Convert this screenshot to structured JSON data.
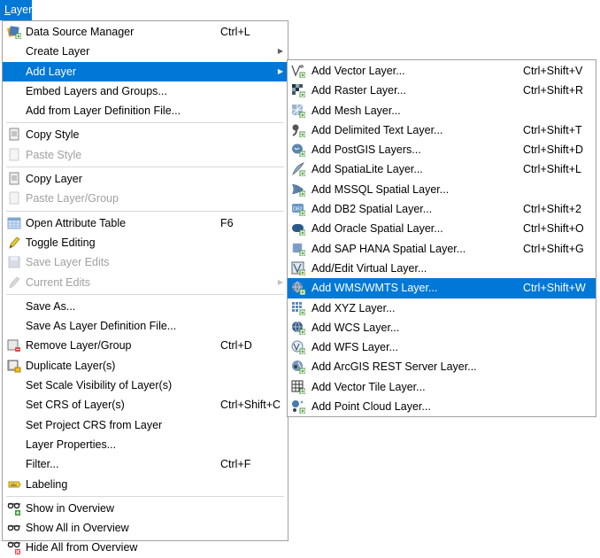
{
  "menubar": {
    "active_menu": "Layer",
    "active_menu_mnemonic": "L",
    "active_menu_rest": "ayer"
  },
  "colors": {
    "highlight": "#0078d7",
    "disabled_text": "#a0a0a0",
    "border": "#a0a0a0"
  },
  "layer_menu": {
    "items": [
      {
        "id": "data-source-manager",
        "label": "Data Source Manager",
        "shortcut": "Ctrl+L",
        "icon": "data-source-manager-icon"
      },
      {
        "id": "create-layer",
        "label": "Create Layer",
        "submenu": true
      },
      {
        "id": "add-layer",
        "label": "Add Layer",
        "submenu": true,
        "highlighted": true
      },
      {
        "id": "embed-layers",
        "label": "Embed Layers and Groups..."
      },
      {
        "id": "add-from-layer-def",
        "label": "Add from Layer Definition File..."
      },
      {
        "separator": true
      },
      {
        "id": "copy-style",
        "label": "Copy Style",
        "icon": "copy-style-icon"
      },
      {
        "id": "paste-style",
        "label": "Paste Style",
        "icon": "paste-style-icon",
        "disabled": true
      },
      {
        "separator": true
      },
      {
        "id": "copy-layer",
        "label": "Copy Layer",
        "icon": "copy-layer-icon"
      },
      {
        "id": "paste-layer-group",
        "label": "Paste Layer/Group",
        "icon": "paste-layer-icon",
        "disabled": true
      },
      {
        "separator": true
      },
      {
        "id": "open-attribute-table",
        "label": "Open Attribute Table",
        "shortcut": "F6",
        "icon": "attribute-table-icon"
      },
      {
        "id": "toggle-editing",
        "label": "Toggle Editing",
        "icon": "pencil-icon"
      },
      {
        "id": "save-layer-edits",
        "label": "Save Layer Edits",
        "icon": "save-edits-icon",
        "disabled": true
      },
      {
        "id": "current-edits",
        "label": "Current Edits",
        "icon": "current-edits-icon",
        "disabled": true,
        "submenu": true
      },
      {
        "separator": true
      },
      {
        "id": "save-as",
        "label": "Save As..."
      },
      {
        "id": "save-as-layer-def",
        "label": "Save As Layer Definition File..."
      },
      {
        "id": "remove-layer-group",
        "label": "Remove Layer/Group",
        "shortcut": "Ctrl+D",
        "icon": "remove-layer-icon"
      },
      {
        "id": "duplicate-layers",
        "label": "Duplicate Layer(s)",
        "icon": "duplicate-layer-icon"
      },
      {
        "id": "set-scale-visibility",
        "label": "Set Scale Visibility of Layer(s)"
      },
      {
        "id": "set-crs-of-layers",
        "label": "Set CRS of Layer(s)",
        "shortcut": "Ctrl+Shift+C"
      },
      {
        "id": "set-project-crs",
        "label": "Set Project CRS from Layer"
      },
      {
        "id": "layer-properties",
        "label": "Layer Properties..."
      },
      {
        "id": "filter",
        "label": "Filter...",
        "shortcut": "Ctrl+F"
      },
      {
        "id": "labeling",
        "label": "Labeling",
        "icon": "labeling-icon"
      },
      {
        "separator": true
      },
      {
        "id": "show-in-overview",
        "label": "Show in Overview",
        "icon": "show-overview-icon"
      },
      {
        "id": "show-all-in-overview",
        "label": "Show All in Overview",
        "icon": "show-all-overview-icon"
      },
      {
        "id": "hide-all-from-overview",
        "label": "Hide All from Overview",
        "icon": "hide-overview-icon"
      }
    ]
  },
  "add_layer_submenu": {
    "items": [
      {
        "id": "add-vector",
        "label": "Add Vector Layer...",
        "shortcut": "Ctrl+Shift+V",
        "icon": "vector-layer-icon"
      },
      {
        "id": "add-raster",
        "label": "Add Raster Layer...",
        "shortcut": "Ctrl+Shift+R",
        "icon": "raster-layer-icon"
      },
      {
        "id": "add-mesh",
        "label": "Add Mesh Layer...",
        "icon": "mesh-layer-icon"
      },
      {
        "id": "add-delimited-text",
        "label": "Add Delimited Text Layer...",
        "shortcut": "Ctrl+Shift+T",
        "icon": "delimited-text-icon"
      },
      {
        "id": "add-postgis",
        "label": "Add PostGIS Layers...",
        "shortcut": "Ctrl+Shift+D",
        "icon": "postgis-icon"
      },
      {
        "id": "add-spatialite",
        "label": "Add SpatiaLite Layer...",
        "shortcut": "Ctrl+Shift+L",
        "icon": "spatialite-icon"
      },
      {
        "id": "add-mssql",
        "label": "Add MSSQL Spatial Layer...",
        "icon": "mssql-icon"
      },
      {
        "id": "add-db2",
        "label": "Add DB2 Spatial Layer...",
        "shortcut": "Ctrl+Shift+2",
        "icon": "db2-icon"
      },
      {
        "id": "add-oracle",
        "label": "Add Oracle Spatial Layer...",
        "shortcut": "Ctrl+Shift+O",
        "icon": "oracle-icon"
      },
      {
        "id": "add-sap-hana",
        "label": "Add SAP HANA Spatial Layer...",
        "shortcut": "Ctrl+Shift+G",
        "icon": "sap-hana-icon"
      },
      {
        "id": "add-virtual",
        "label": "Add/Edit Virtual Layer...",
        "icon": "virtual-layer-icon"
      },
      {
        "id": "add-wms-wmts",
        "label": "Add WMS/WMTS Layer...",
        "shortcut": "Ctrl+Shift+W",
        "icon": "wms-icon",
        "highlighted": true
      },
      {
        "id": "add-xyz",
        "label": "Add XYZ Layer...",
        "icon": "xyz-icon"
      },
      {
        "id": "add-wcs",
        "label": "Add WCS Layer...",
        "icon": "wcs-icon"
      },
      {
        "id": "add-wfs",
        "label": "Add WFS Layer...",
        "icon": "wfs-icon"
      },
      {
        "id": "add-arcgis-rest",
        "label": "Add ArcGIS REST Server Layer...",
        "icon": "arcgis-rest-icon"
      },
      {
        "id": "add-vector-tile",
        "label": "Add Vector Tile Layer...",
        "icon": "vector-tile-icon"
      },
      {
        "id": "add-point-cloud",
        "label": "Add Point Cloud Layer...",
        "icon": "point-cloud-icon"
      }
    ]
  }
}
